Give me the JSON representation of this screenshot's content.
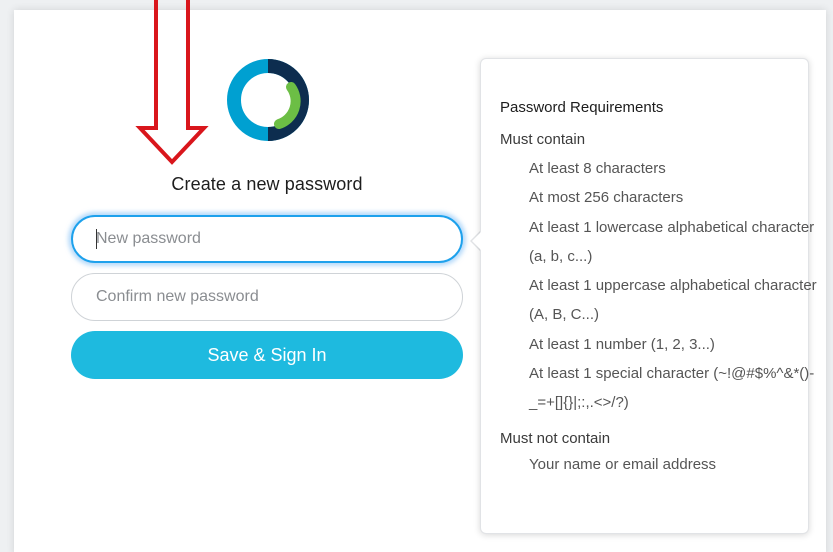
{
  "header": {
    "title": "Create a new password"
  },
  "form": {
    "new_password_placeholder": "New password",
    "confirm_password_placeholder": "Confirm new password",
    "submit_label": "Save & Sign In"
  },
  "requirements": {
    "title": "Password Requirements",
    "must_contain_label": "Must contain",
    "must_contain": [
      "At least 8 characters",
      "At most 256 characters",
      "At least 1 lowercase alphabetical character (a, b, c...)",
      "At least 1 uppercase alphabetical character (A, B, C...)",
      "At least 1 number (1, 2, 3...)",
      "At least 1 special character (~!@#$%^&*()-_=+[]{}|;:,.<>/?)"
    ],
    "must_not_contain_label": "Must not contain",
    "must_not_contain": [
      "Your name or email address"
    ]
  },
  "colors": {
    "button": "#1ebadf",
    "focus_border": "#1da1ec",
    "annotation_arrow": "#d9161c",
    "logo_blue": "#00a0d1",
    "logo_green": "#6cbe45",
    "logo_navy": "#0d2d4f"
  },
  "icons": {
    "logo": "webex-logo-icon",
    "annotation": "down-arrow-icon"
  }
}
